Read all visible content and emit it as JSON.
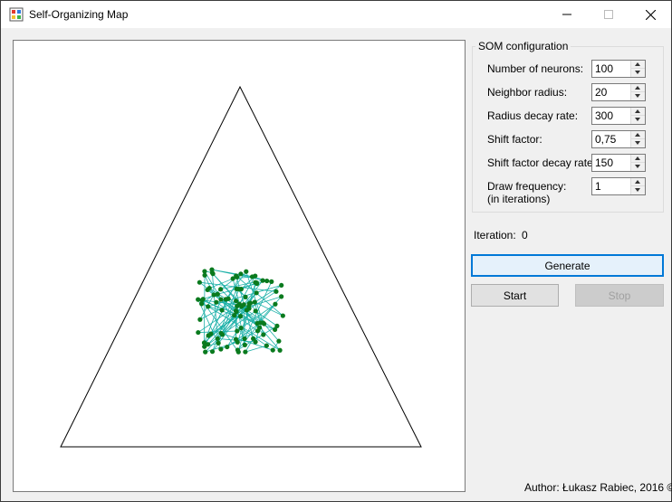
{
  "window": {
    "title": "Self-Organizing Map"
  },
  "config": {
    "group_title": "SOM configuration",
    "fields": [
      {
        "label": "Number of neurons:",
        "value": "100"
      },
      {
        "label": "Neighbor radius:",
        "value": "20"
      },
      {
        "label": "Radius decay rate:",
        "value": "300"
      },
      {
        "label": "Shift factor:",
        "value": "0,75"
      },
      {
        "label": "Shift factor decay rate:",
        "value": "150"
      },
      {
        "label": "Draw frequency:",
        "sublabel": "(in iterations)",
        "value": "1"
      }
    ]
  },
  "iteration": {
    "label": "Iteration:",
    "value": "0"
  },
  "buttons": {
    "generate": "Generate",
    "start": "Start",
    "stop": "Stop"
  },
  "author": "Author: Łukasz Rabiec, 2016 ©",
  "colors": {
    "neuron": "#0a7a1e",
    "link": "#1bb0a8",
    "triangle": "#000000"
  },
  "icons": {
    "app": "app-icon",
    "minimize": "minimize-icon",
    "maximize": "maximize-icon",
    "close": "close-icon"
  }
}
